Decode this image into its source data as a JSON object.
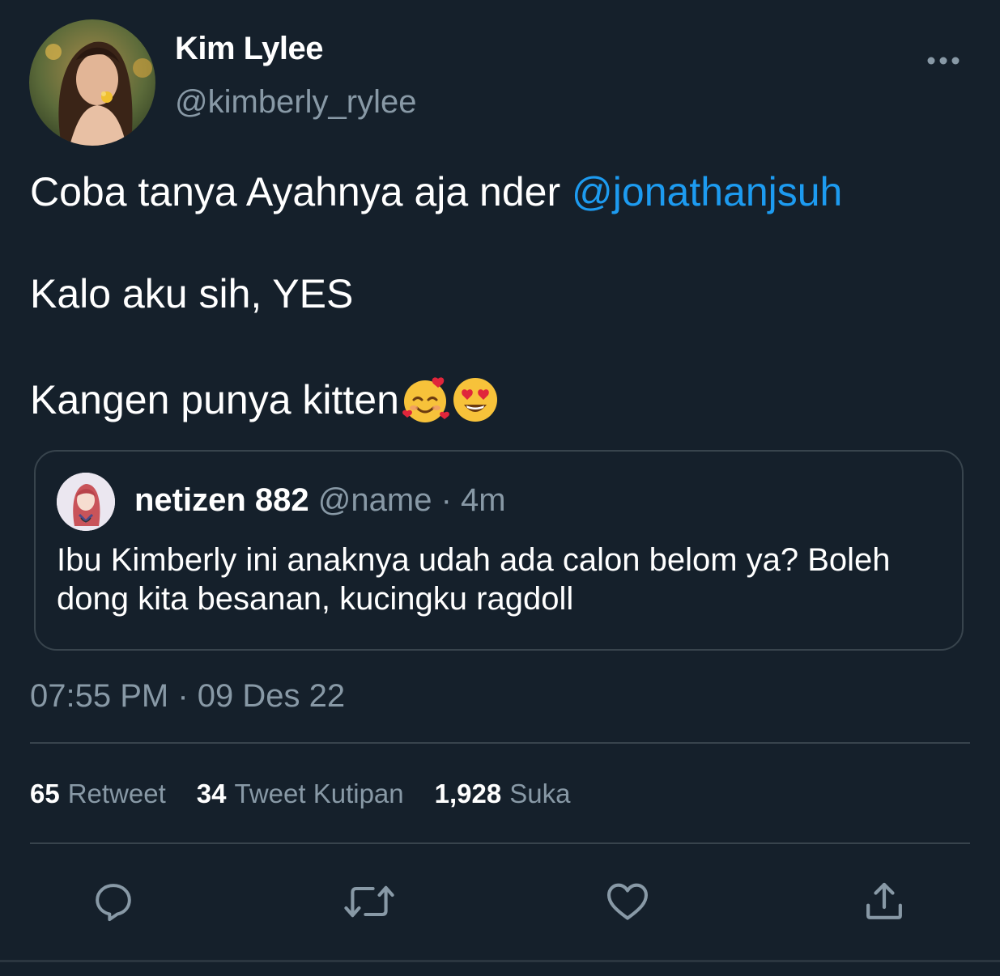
{
  "author": {
    "display_name": "Kim Lylee",
    "handle": "@kimberly_rylee"
  },
  "tweet": {
    "line1_text": "Coba tanya Ayahnya aja nder ",
    "mention": "@jonathanjsuh",
    "line2_text": "Kalo aku sih, YES",
    "line3_text": "Kangen punya kitten",
    "emojis": [
      "smiling-face-with-hearts",
      "heart-eyes"
    ]
  },
  "quoted_tweet": {
    "display_name": "netizen 882",
    "handle": "@name",
    "separator": " · ",
    "time": "4m",
    "text": "Ibu Kimberly ini anaknya udah ada calon belom ya? Boleh dong kita besanan, kucingku ragdoll"
  },
  "timestamp": "07:55 PM · 09 Des 22",
  "stats": [
    {
      "count": "65",
      "label": "Retweet"
    },
    {
      "count": "34",
      "label": "Tweet Kutipan"
    },
    {
      "count": "1,928",
      "label": "Suka"
    }
  ],
  "actions": [
    "reply-icon",
    "retweet-icon",
    "like-icon",
    "share-icon"
  ],
  "colors": {
    "background": "#15202b",
    "mention": "#1d9bf0",
    "secondary_text": "#8899a6",
    "border": "#38444d"
  }
}
